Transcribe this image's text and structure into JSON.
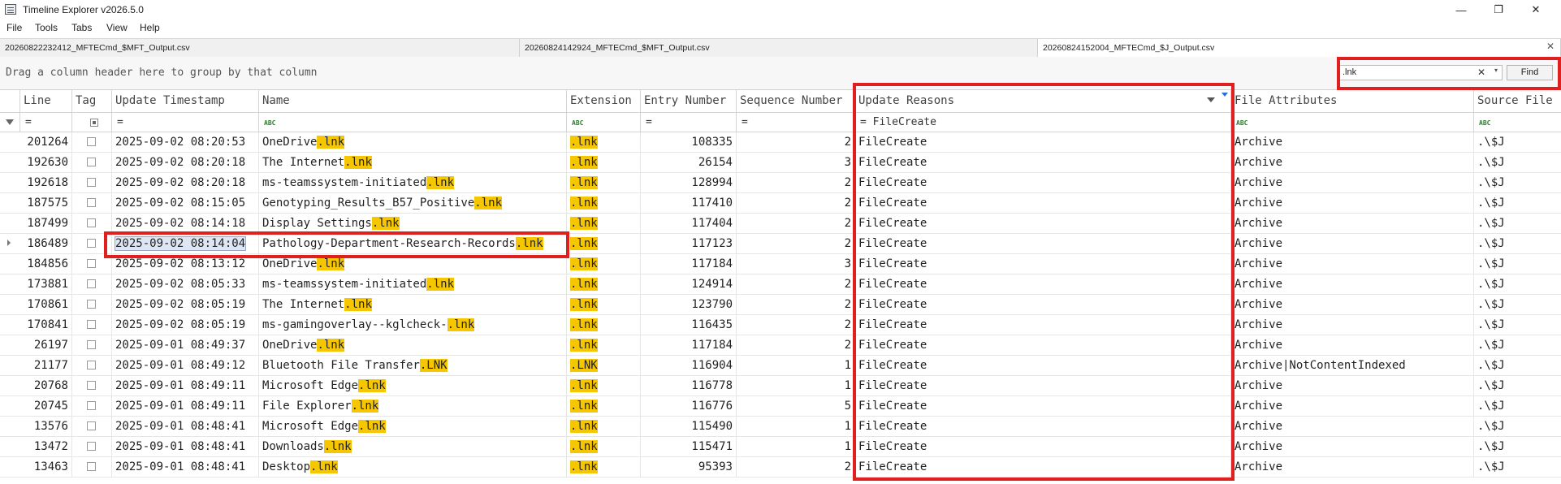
{
  "window": {
    "title": "Timeline Explorer v2026.5.0",
    "minimize": "—",
    "maximize": "❐",
    "close": "✕"
  },
  "menu": [
    "File",
    "Tools",
    "Tabs",
    "View",
    "Help"
  ],
  "tabs": [
    {
      "label": "20260822232412_MFTECmd_$MFT_Output.csv",
      "active": false
    },
    {
      "label": "20260824142924_MFTECmd_$MFT_Output.csv",
      "active": false
    },
    {
      "label": "20260824152004_MFTECmd_$J_Output.csv",
      "active": true
    }
  ],
  "tab_close": "✕",
  "group_hint": "Drag a column header here to group by that column",
  "search": {
    "value": ".lnk",
    "clear": "✕",
    "dropdown": "▾",
    "find_label": "Find"
  },
  "columns": [
    "Line",
    "Tag",
    "Update Timestamp",
    "Name",
    "Extension",
    "Entry Number",
    "Sequence Number",
    "Update Reasons",
    "File Attributes",
    "Source File"
  ],
  "filter_row": {
    "eq": "=",
    "abc_a": "A",
    "abc_b": "B",
    "abc_c": "C",
    "update_reasons": "FileCreate"
  },
  "rows": [
    {
      "line": "201264",
      "ts": "2025-09-02 08:20:53",
      "name_base": "OneDrive",
      "name_ext": ".lnk",
      "ext": ".lnk",
      "entry": "108335",
      "seq": "2",
      "reason": "FileCreate",
      "attrs": "Archive",
      "source": ".\\$J"
    },
    {
      "line": "192630",
      "ts": "2025-09-02 08:20:18",
      "name_base": "The Internet",
      "name_ext": ".lnk",
      "ext": ".lnk",
      "entry": "26154",
      "seq": "3",
      "reason": "FileCreate",
      "attrs": "Archive",
      "source": ".\\$J"
    },
    {
      "line": "192618",
      "ts": "2025-09-02 08:20:18",
      "name_base": "ms-teamssystem-initiated",
      "name_ext": ".lnk",
      "ext": ".lnk",
      "entry": "128994",
      "seq": "2",
      "reason": "FileCreate",
      "attrs": "Archive",
      "source": ".\\$J"
    },
    {
      "line": "187575",
      "ts": "2025-09-02 08:15:05",
      "name_base": "Genotyping_Results_B57_Positive",
      "name_ext": ".lnk",
      "ext": ".lnk",
      "entry": "117410",
      "seq": "2",
      "reason": "FileCreate",
      "attrs": "Archive",
      "source": ".\\$J"
    },
    {
      "line": "187499",
      "ts": "2025-09-02 08:14:18",
      "name_base": "Display Settings",
      "name_ext": ".lnk",
      "ext": ".lnk",
      "entry": "117404",
      "seq": "2",
      "reason": "FileCreate",
      "attrs": "Archive",
      "source": ".\\$J"
    },
    {
      "line": "186489",
      "ts": "2025-09-02 08:14:04",
      "name_base": "Pathology-Department-Research-Records",
      "name_ext": ".lnk",
      "ext": ".lnk",
      "entry": "117123",
      "seq": "2",
      "reason": "FileCreate",
      "attrs": "Archive",
      "source": ".\\$J",
      "selected": true
    },
    {
      "line": "184856",
      "ts": "2025-09-02 08:13:12",
      "name_base": "OneDrive",
      "name_ext": ".lnk",
      "ext": ".lnk",
      "entry": "117184",
      "seq": "3",
      "reason": "FileCreate",
      "attrs": "Archive",
      "source": ".\\$J"
    },
    {
      "line": "173881",
      "ts": "2025-09-02 08:05:33",
      "name_base": "ms-teamssystem-initiated",
      "name_ext": ".lnk",
      "ext": ".lnk",
      "entry": "124914",
      "seq": "2",
      "reason": "FileCreate",
      "attrs": "Archive",
      "source": ".\\$J"
    },
    {
      "line": "170861",
      "ts": "2025-09-02 08:05:19",
      "name_base": "The Internet",
      "name_ext": ".lnk",
      "ext": ".lnk",
      "entry": "123790",
      "seq": "2",
      "reason": "FileCreate",
      "attrs": "Archive",
      "source": ".\\$J"
    },
    {
      "line": "170841",
      "ts": "2025-09-02 08:05:19",
      "name_base": "ms-gamingoverlay--kglcheck-",
      "name_ext": ".lnk",
      "ext": ".lnk",
      "entry": "116435",
      "seq": "2",
      "reason": "FileCreate",
      "attrs": "Archive",
      "source": ".\\$J"
    },
    {
      "line": "26197",
      "ts": "2025-09-01 08:49:37",
      "name_base": "OneDrive",
      "name_ext": ".lnk",
      "ext": ".lnk",
      "entry": "117184",
      "seq": "2",
      "reason": "FileCreate",
      "attrs": "Archive",
      "source": ".\\$J"
    },
    {
      "line": "21177",
      "ts": "2025-09-01 08:49:12",
      "name_base": "Bluetooth File Transfer",
      "name_ext": ".LNK",
      "ext": ".LNK",
      "entry": "116904",
      "seq": "1",
      "reason": "FileCreate",
      "attrs": "Archive|NotContentIndexed",
      "source": ".\\$J"
    },
    {
      "line": "20768",
      "ts": "2025-09-01 08:49:11",
      "name_base": "Microsoft Edge",
      "name_ext": ".lnk",
      "ext": ".lnk",
      "entry": "116778",
      "seq": "1",
      "reason": "FileCreate",
      "attrs": "Archive",
      "source": ".\\$J"
    },
    {
      "line": "20745",
      "ts": "2025-09-01 08:49:11",
      "name_base": "File Explorer",
      "name_ext": ".lnk",
      "ext": ".lnk",
      "entry": "116776",
      "seq": "5",
      "reason": "FileCreate",
      "attrs": "Archive",
      "source": ".\\$J"
    },
    {
      "line": "13576",
      "ts": "2025-09-01 08:48:41",
      "name_base": "Microsoft Edge",
      "name_ext": ".lnk",
      "ext": ".lnk",
      "entry": "115490",
      "seq": "1",
      "reason": "FileCreate",
      "attrs": "Archive",
      "source": ".\\$J"
    },
    {
      "line": "13472",
      "ts": "2025-09-01 08:48:41",
      "name_base": "Downloads",
      "name_ext": ".lnk",
      "ext": ".lnk",
      "entry": "115471",
      "seq": "1",
      "reason": "FileCreate",
      "attrs": "Archive",
      "source": ".\\$J"
    },
    {
      "line": "13463",
      "ts": "2025-09-01 08:48:41",
      "name_base": "Desktop",
      "name_ext": ".lnk",
      "ext": ".lnk",
      "entry": "95393",
      "seq": "2",
      "reason": "FileCreate",
      "attrs": "Archive",
      "source": ".\\$J"
    }
  ],
  "colors": {
    "highlight": "#f6c700",
    "annotation": "#e01f1f",
    "selection": "#dde6f2"
  }
}
